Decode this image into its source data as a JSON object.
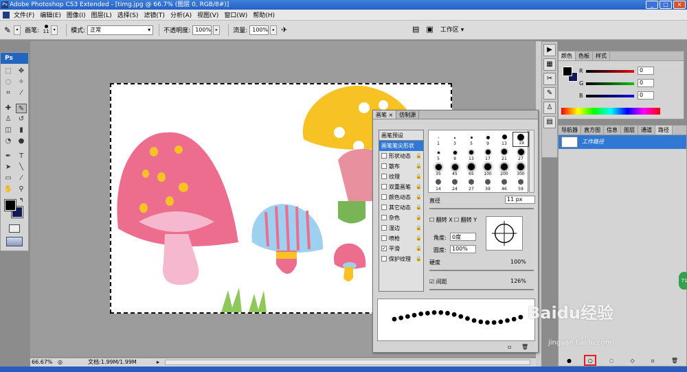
{
  "window": {
    "title": "Adobe Photoshop CS3 Extended - [timg.jpg @ 66.7% (图层 0, RGB/8#)]",
    "icon": "photoshop-icon"
  },
  "menu": [
    "文件(F)",
    "编辑(E)",
    "图像(I)",
    "图层(L)",
    "选择(S)",
    "滤镜(T)",
    "分析(A)",
    "视图(V)",
    "窗口(W)",
    "帮助(H)"
  ],
  "options": {
    "brush_label": "画笔:",
    "brush_size": "11",
    "mode_label": "模式:",
    "mode_value": "正常",
    "opacity_label": "不透明度:",
    "opacity_value": "100%",
    "flow_label": "流量:",
    "flow_value": "100%",
    "workspace": "工作区"
  },
  "toolbox": {
    "logo": "Ps"
  },
  "status": {
    "zoom": "66.67%",
    "doc": "文档:1.99M/1.99M"
  },
  "color_panel": {
    "tabs": [
      "颜色",
      "色板",
      "样式"
    ],
    "channels": [
      {
        "label": "R",
        "value": "0",
        "color": "#c81e1e"
      },
      {
        "label": "G",
        "value": "0",
        "color": "#1aa01a"
      },
      {
        "label": "B",
        "value": "0",
        "color": "#1e1ec8"
      }
    ]
  },
  "paths_panel": {
    "tabs": [
      "导航器",
      "直方图",
      "信息",
      "图层",
      "通道",
      "路径"
    ],
    "item": "工作路径"
  },
  "brush_panel": {
    "tabs": [
      "画笔",
      "仿制源"
    ],
    "presets_header": "画笔预设",
    "selected": "画笔笔尖形状",
    "options": [
      {
        "label": "形状动态",
        "checked": false
      },
      {
        "label": "散布",
        "checked": false
      },
      {
        "label": "纹理",
        "checked": false
      },
      {
        "label": "双重画笔",
        "checked": false
      },
      {
        "label": "颜色动态",
        "checked": false
      },
      {
        "label": "其它动态",
        "checked": false
      },
      {
        "label": "杂色",
        "checked": false
      },
      {
        "label": "湿边",
        "checked": false
      },
      {
        "label": "喷枪",
        "checked": false
      },
      {
        "label": "平滑",
        "checked": true
      },
      {
        "label": "保护纹理",
        "checked": false
      }
    ],
    "tips": [
      "1",
      "3",
      "5",
      "9",
      "13",
      "19",
      "5",
      "9",
      "13",
      "17",
      "21",
      "27",
      "35",
      "45",
      "65",
      "100",
      "200",
      "300",
      "14",
      "24",
      "27",
      "39",
      "46",
      "59"
    ],
    "diameter_label": "直径",
    "diameter_value": "11 px",
    "flipx": "翻转 X",
    "flipy": "翻转 Y",
    "angle_label": "角度:",
    "angle_value": "0度",
    "roundness_label": "圆度:",
    "roundness_value": "100%",
    "hardness_label": "硬度",
    "hardness_value": "100%",
    "spacing_label": "间距",
    "spacing_value": "126%"
  },
  "watermark": {
    "brand": "Baidu经验",
    "url": "jingyan.baidu.com"
  },
  "badge": "71"
}
